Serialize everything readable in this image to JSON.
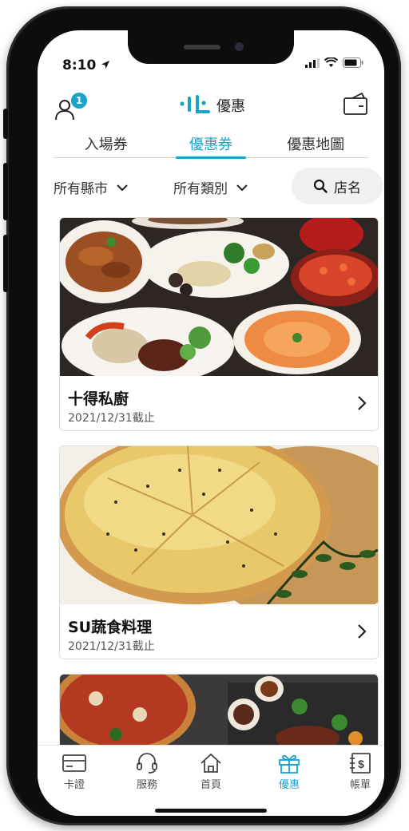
{
  "status_bar": {
    "time": "8:10"
  },
  "header": {
    "logo_text": "優惠",
    "notification_count": "1"
  },
  "tabs": [
    {
      "label": "入場券",
      "active": false
    },
    {
      "label": "優惠券",
      "active": true
    },
    {
      "label": "優惠地圖",
      "active": false
    }
  ],
  "filters": {
    "city": "所有縣市",
    "category": "所有類別",
    "search_label": "店名"
  },
  "coupons": [
    {
      "name": "十得私廚",
      "expiry": "2021/12/31截止"
    },
    {
      "name": "SU蔬食料理",
      "expiry": "2021/12/31截止"
    }
  ],
  "tabbar": [
    {
      "label": "卡證",
      "icon": "card-icon",
      "active": false
    },
    {
      "label": "服務",
      "icon": "headset-icon",
      "active": false
    },
    {
      "label": "首頁",
      "icon": "home-icon",
      "active": false
    },
    {
      "label": "優惠",
      "icon": "gift-icon",
      "active": true
    },
    {
      "label": "帳單",
      "icon": "bill-icon",
      "active": false
    }
  ],
  "colors": {
    "accent": "#19a3c8",
    "text": "#222222",
    "divider": "#dcdcdc"
  }
}
